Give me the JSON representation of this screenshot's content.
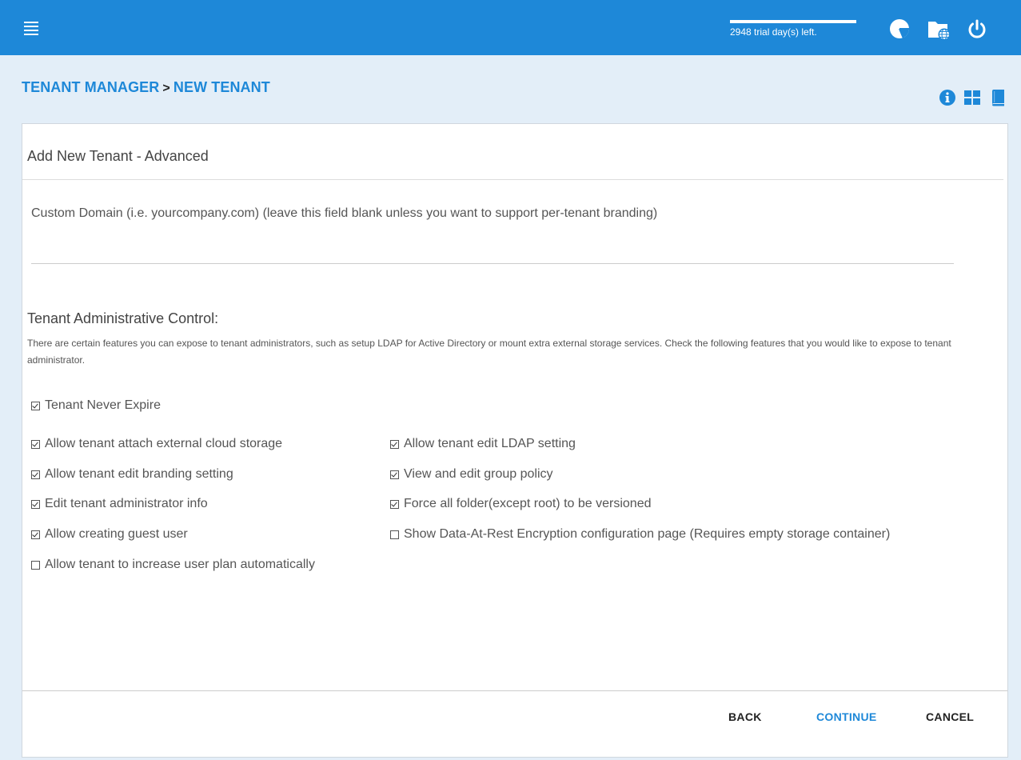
{
  "header": {
    "menu_icon": "hamburger-menu-icon",
    "trial_text": "2948 trial day(s) left.",
    "icons": [
      "pie-chart-icon",
      "web-folder-icon",
      "power-icon"
    ],
    "color": "#1e88d8"
  },
  "breadcrumb": {
    "parent": "TENANT MANAGER",
    "separator": ">",
    "current": "NEW TENANT"
  },
  "page_icons": [
    "info-icon",
    "grid-icon",
    "book-icon"
  ],
  "panel": {
    "title": "Add New Tenant - Advanced",
    "domain_label": "Custom Domain (i.e. yourcompany.com) (leave this field blank unless you want to support per-tenant branding)",
    "domain_value": "",
    "section_title": "Tenant Administrative Control:",
    "section_desc": "There are certain features you can expose to tenant administrators, such as setup LDAP for Active Directory or mount extra external storage services. Check the following features that you would like to expose to tenant administrator.",
    "options": [
      {
        "label": "Tenant Never Expire",
        "checked": true
      },
      {
        "label": "Allow tenant attach external cloud storage",
        "checked": true
      },
      {
        "label": "Allow tenant edit LDAP setting",
        "checked": true
      },
      {
        "label": "Allow tenant edit branding setting",
        "checked": true
      },
      {
        "label": "View and edit group policy",
        "checked": true
      },
      {
        "label": "Edit tenant administrator info",
        "checked": true
      },
      {
        "label": "Force all folder(except root) to be versioned",
        "checked": true
      },
      {
        "label": "Allow creating guest user",
        "checked": true
      },
      {
        "label": "Show Data-At-Rest Encryption configuration page (Requires empty storage container)",
        "checked": false
      },
      {
        "label": "Allow tenant to increase user plan automatically",
        "checked": false
      }
    ]
  },
  "buttons": {
    "back": "BACK",
    "continue": "CONTINUE",
    "cancel": "CANCEL"
  }
}
